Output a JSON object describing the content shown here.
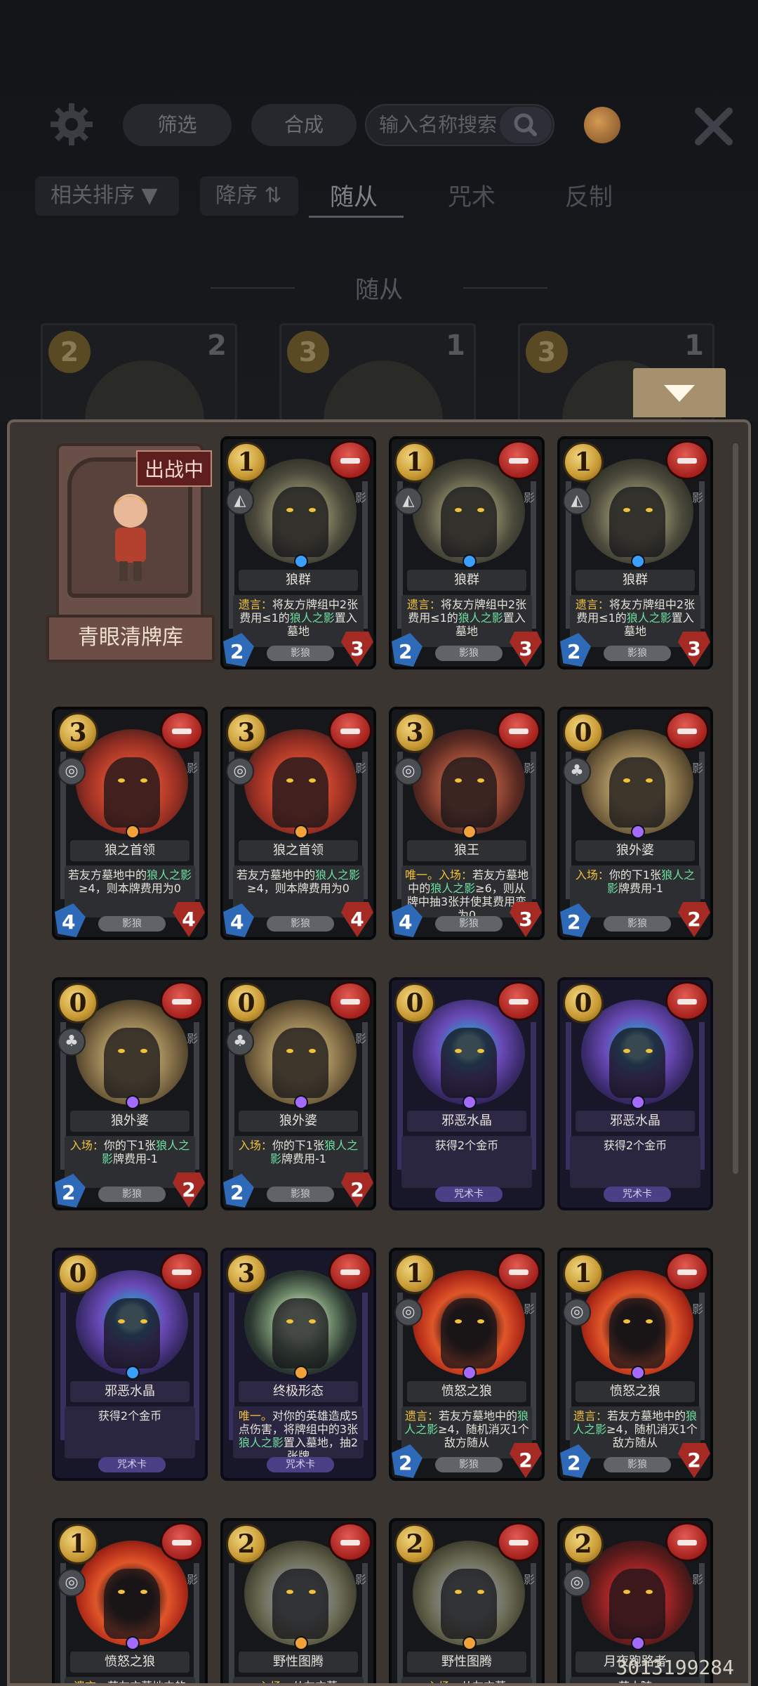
{
  "toolbar": {
    "filter_label": "筛选",
    "craft_label": "合成",
    "search_placeholder": "输入名称搜索"
  },
  "tabs": {
    "relevance_sort": "相关排序",
    "descending_sort": "降序",
    "items": [
      "随从",
      "咒术",
      "反制"
    ],
    "active": "随从"
  },
  "section_title": "随从",
  "background_cards": [
    {
      "cost": "2",
      "num": "2"
    },
    {
      "cost": "3",
      "num": "1"
    },
    {
      "cost": "3",
      "num": "1"
    }
  ],
  "deck": {
    "status_tag": "出战中",
    "name": "青眼清牌库"
  },
  "cards": [
    {
      "id": "wolfpack1",
      "cost": "1",
      "name": "狼群",
      "art": "wolfpack",
      "gem": "#3aa0ff",
      "icon": "◭",
      "desc_pre": "遗言：",
      "desc": "将友方牌组中2张费用≤1的",
      "hl": "狼人之影",
      "desc_post": "置入墓地",
      "atk": "2",
      "hp": "3",
      "foot": "影狼",
      "spell": false
    },
    {
      "id": "wolfpack2",
      "cost": "1",
      "name": "狼群",
      "art": "wolfpack",
      "gem": "#3aa0ff",
      "icon": "◭",
      "desc_pre": "遗言：",
      "desc": "将友方牌组中2张费用≤1的",
      "hl": "狼人之影",
      "desc_post": "置入墓地",
      "atk": "2",
      "hp": "3",
      "foot": "影狼",
      "spell": false
    },
    {
      "id": "wolfpack3",
      "cost": "1",
      "name": "狼群",
      "art": "wolfpack",
      "gem": "#3aa0ff",
      "icon": "◭",
      "desc_pre": "遗言：",
      "desc": "将友方牌组中2张费用≤1的",
      "hl": "狼人之影",
      "desc_post": "置入墓地",
      "atk": "2",
      "hp": "3",
      "foot": "影狼",
      "spell": false
    },
    {
      "id": "leader1",
      "cost": "3",
      "name": "狼之首领",
      "art": "wolfleader",
      "gem": "#f2a23a",
      "icon": "◎",
      "desc_pre": "",
      "desc": "若友方墓地中的",
      "hl": "狼人之影",
      "desc_post": "≥4，则本牌费用为0",
      "atk": "4",
      "hp": "4",
      "foot": "影狼",
      "spell": false
    },
    {
      "id": "leader2",
      "cost": "3",
      "name": "狼之首领",
      "art": "wolfleader",
      "gem": "#f2a23a",
      "icon": "◎",
      "desc_pre": "",
      "desc": "若友方墓地中的",
      "hl": "狼人之影",
      "desc_post": "≥4，则本牌费用为0",
      "atk": "4",
      "hp": "4",
      "foot": "影狼",
      "spell": false
    },
    {
      "id": "wolfking",
      "cost": "3",
      "name": "狼王",
      "art": "wolfking",
      "gem": "#f2a23a",
      "icon": "◎",
      "desc_pre": "唯一。入场：",
      "desc": "若友方墓地中的",
      "hl": "狼人之影",
      "desc_post": "≥6，则从牌中抽3张并使其费用变为0",
      "atk": "4",
      "hp": "3",
      "foot": "影狼",
      "spell": false
    },
    {
      "id": "granny1",
      "cost": "0",
      "name": "狼外婆",
      "art": "granny",
      "gem": "#a36bff",
      "icon": "♣",
      "desc_pre": "入场：",
      "desc": "你的下1张",
      "hl": "狼人之影",
      "desc_post": "牌费用-1",
      "atk": "2",
      "hp": "2",
      "foot": "影狼",
      "spell": false
    },
    {
      "id": "granny2",
      "cost": "0",
      "name": "狼外婆",
      "art": "granny",
      "gem": "#a36bff",
      "icon": "♣",
      "desc_pre": "入场：",
      "desc": "你的下1张",
      "hl": "狼人之影",
      "desc_post": "牌费用-1",
      "atk": "2",
      "hp": "2",
      "foot": "影狼",
      "spell": false
    },
    {
      "id": "granny3",
      "cost": "0",
      "name": "狼外婆",
      "art": "granny",
      "gem": "#a36bff",
      "icon": "♣",
      "desc_pre": "入场：",
      "desc": "你的下1张",
      "hl": "狼人之影",
      "desc_post": "牌费用-1",
      "atk": "2",
      "hp": "2",
      "foot": "影狼",
      "spell": false
    },
    {
      "id": "crystal1",
      "cost": "0",
      "name": "邪恶水晶",
      "art": "crystal",
      "gem": "#a36bff",
      "icon": "",
      "desc_pre": "",
      "desc": "获得2个金币",
      "hl": "",
      "desc_post": "",
      "atk": "",
      "hp": "",
      "foot": "咒术卡",
      "spell": true
    },
    {
      "id": "crystal2",
      "cost": "0",
      "name": "邪恶水晶",
      "art": "crystal",
      "gem": "#a36bff",
      "icon": "",
      "desc_pre": "",
      "desc": "获得2个金币",
      "hl": "",
      "desc_post": "",
      "atk": "",
      "hp": "",
      "foot": "咒术卡",
      "spell": true
    },
    {
      "id": "crystal3",
      "cost": "0",
      "name": "邪恶水晶",
      "art": "crystal",
      "gem": "#3aa0ff",
      "icon": "",
      "desc_pre": "",
      "desc": "获得2个金币",
      "hl": "",
      "desc_post": "",
      "atk": "",
      "hp": "",
      "foot": "咒术卡",
      "spell": true
    },
    {
      "id": "ultimate",
      "cost": "3",
      "name": "终极形态",
      "art": "ultimate",
      "gem": "#f2a23a",
      "icon": "",
      "desc_pre": "唯一。",
      "desc": "对你的英雄造成5点伤害，将牌组中的3张",
      "hl": "狼人之影",
      "desc_post": "置入墓地，抽2张牌",
      "atk": "",
      "hp": "",
      "foot": "咒术卡",
      "spell": true
    },
    {
      "id": "angry1",
      "cost": "1",
      "name": "愤怒之狼",
      "art": "angrywolf",
      "gem": "#a36bff",
      "icon": "◎",
      "desc_pre": "遗言：",
      "desc": "若友方墓地中的",
      "hl": "狼人之影",
      "desc_post": "≥4，随机消灭1个敌方随从",
      "atk": "2",
      "hp": "2",
      "foot": "影狼",
      "spell": false
    },
    {
      "id": "angry2",
      "cost": "1",
      "name": "愤怒之狼",
      "art": "angrywolf",
      "gem": "#a36bff",
      "icon": "◎",
      "desc_pre": "遗言：",
      "desc": "若友方墓地中的",
      "hl": "狼人之影",
      "desc_post": "≥4，随机消灭1个敌方随从",
      "atk": "2",
      "hp": "2",
      "foot": "影狼",
      "spell": false
    },
    {
      "id": "angry3",
      "cost": "1",
      "name": "愤怒之狼",
      "art": "angrywolf",
      "gem": "#a36bff",
      "icon": "◎",
      "desc_pre": "遗言：",
      "desc": "若友方墓地中的",
      "hl": "",
      "desc_post": "",
      "atk": "",
      "hp": "",
      "foot": "",
      "spell": false
    },
    {
      "id": "totem1",
      "cost": "2",
      "name": "野性图腾",
      "art": "totem",
      "gem": "#f2a23a",
      "icon": "",
      "desc_pre": "入场：",
      "desc": "从友方墓",
      "hl": "",
      "desc_post": "",
      "atk": "",
      "hp": "",
      "foot": "",
      "spell": false
    },
    {
      "id": "totem2",
      "cost": "2",
      "name": "野性图腾",
      "art": "totem",
      "gem": "#f2a23a",
      "icon": "",
      "desc_pre": "入场：",
      "desc": "从友方墓",
      "hl": "",
      "desc_post": "",
      "atk": "",
      "hp": "",
      "foot": "",
      "spell": false
    },
    {
      "id": "runner",
      "cost": "2",
      "name": "月夜跑路者",
      "art": "runner",
      "gem": "#a36bff",
      "icon": "◎",
      "desc_pre": "",
      "desc": "若本随",
      "hl": "",
      "desc_post": "",
      "atk": "",
      "hp": "",
      "foot": "",
      "spell": false
    }
  ],
  "watermark": "3013199284"
}
